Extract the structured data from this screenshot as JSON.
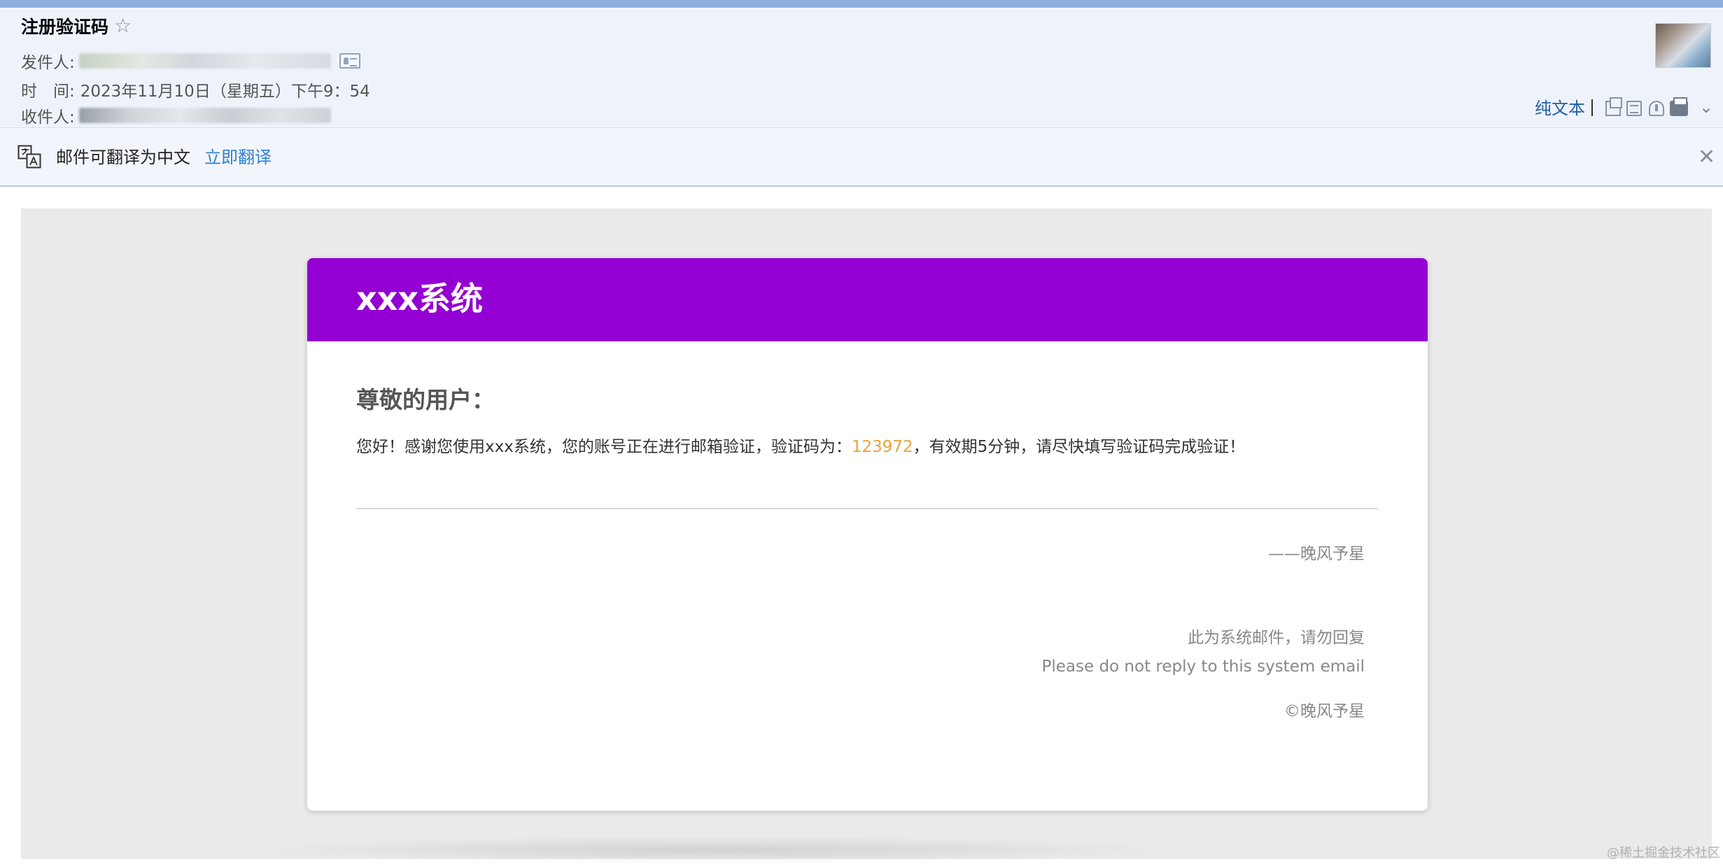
{
  "header": {
    "subject": "注册验证码",
    "sender_label": "发件人:",
    "time_label": "时　间:",
    "time_value": "2023年11月10日（星期五）下午9：54",
    "recipient_label": "收件人:",
    "plain_text_label": "纯文本"
  },
  "translate_bar": {
    "text": "邮件可翻译为中文",
    "link": "立即翻译"
  },
  "email": {
    "system_title": "xxx系统",
    "greeting": "尊敬的用户：",
    "message_prefix": "您好！感谢您使用xxx系统，您的账号正在进行邮箱验证，验证码为：",
    "verification_code": "123972",
    "message_suffix": "，有效期5分钟，请尽快填写验证码完成验证！",
    "signature": "——晚风予星",
    "footer_cn": "此为系统邮件，请勿回复",
    "footer_en": "Please do not reply to this system email",
    "copyright": "©晚风予星",
    "header_color": "#9400d3",
    "code_color": "#e8a33d"
  },
  "icons": {
    "star": "☆",
    "close": "✕",
    "expand": "⌄"
  },
  "watermark": "@稀土掘金技术社区"
}
